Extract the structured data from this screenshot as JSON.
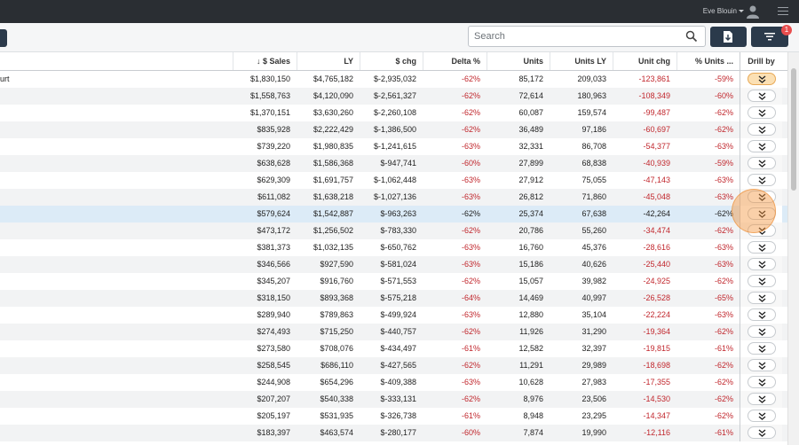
{
  "header": {
    "user_name": "Eve Blouin"
  },
  "toolbar": {
    "search_placeholder": "Search",
    "filter_badge": "1"
  },
  "columns": {
    "sales": "↓ $ Sales",
    "ly": "LY",
    "chg": "$ chg",
    "delta": "Delta %",
    "units": "Units",
    "units_ly": "Units LY",
    "unit_chg": "Unit chg",
    "pct_units": "% Units ...",
    "drill": "Drill by"
  },
  "rows": [
    {
      "name": "urt",
      "sales": "$1,830,150",
      "ly": "$4,765,182",
      "chg": "$-2,935,032",
      "delta": "-62%",
      "units": "85,172",
      "units_ly": "209,033",
      "unit_chg": "-123,861",
      "pct": "-59%"
    },
    {
      "name": "",
      "sales": "$1,558,763",
      "ly": "$4,120,090",
      "chg": "$-2,561,327",
      "delta": "-62%",
      "units": "72,614",
      "units_ly": "180,963",
      "unit_chg": "-108,349",
      "pct": "-60%"
    },
    {
      "name": "",
      "sales": "$1,370,151",
      "ly": "$3,630,260",
      "chg": "$-2,260,108",
      "delta": "-62%",
      "units": "60,087",
      "units_ly": "159,574",
      "unit_chg": "-99,487",
      "pct": "-62%"
    },
    {
      "name": "",
      "sales": "$835,928",
      "ly": "$2,222,429",
      "chg": "$-1,386,500",
      "delta": "-62%",
      "units": "36,489",
      "units_ly": "97,186",
      "unit_chg": "-60,697",
      "pct": "-62%"
    },
    {
      "name": "",
      "sales": "$739,220",
      "ly": "$1,980,835",
      "chg": "$-1,241,615",
      "delta": "-63%",
      "units": "32,331",
      "units_ly": "86,708",
      "unit_chg": "-54,377",
      "pct": "-63%"
    },
    {
      "name": "",
      "sales": "$638,628",
      "ly": "$1,586,368",
      "chg": "$-947,741",
      "delta": "-60%",
      "units": "27,899",
      "units_ly": "68,838",
      "unit_chg": "-40,939",
      "pct": "-59%"
    },
    {
      "name": "",
      "sales": "$629,309",
      "ly": "$1,691,757",
      "chg": "$-1,062,448",
      "delta": "-63%",
      "units": "27,912",
      "units_ly": "75,055",
      "unit_chg": "-47,143",
      "pct": "-63%"
    },
    {
      "name": "",
      "sales": "$611,082",
      "ly": "$1,638,218",
      "chg": "$-1,027,136",
      "delta": "-63%",
      "units": "26,812",
      "units_ly": "71,860",
      "unit_chg": "-45,048",
      "pct": "-63%"
    },
    {
      "name": "",
      "sales": "$579,624",
      "ly": "$1,542,887",
      "chg": "$-963,263",
      "delta": "-62%",
      "units": "25,374",
      "units_ly": "67,638",
      "unit_chg": "-42,264",
      "pct": "-62%"
    },
    {
      "name": "",
      "sales": "$473,172",
      "ly": "$1,256,502",
      "chg": "$-783,330",
      "delta": "-62%",
      "units": "20,786",
      "units_ly": "55,260",
      "unit_chg": "-34,474",
      "pct": "-62%"
    },
    {
      "name": "",
      "sales": "$381,373",
      "ly": "$1,032,135",
      "chg": "$-650,762",
      "delta": "-63%",
      "units": "16,760",
      "units_ly": "45,376",
      "unit_chg": "-28,616",
      "pct": "-63%"
    },
    {
      "name": "",
      "sales": "$346,566",
      "ly": "$927,590",
      "chg": "$-581,024",
      "delta": "-63%",
      "units": "15,186",
      "units_ly": "40,626",
      "unit_chg": "-25,440",
      "pct": "-63%"
    },
    {
      "name": "",
      "sales": "$345,207",
      "ly": "$916,760",
      "chg": "$-571,553",
      "delta": "-62%",
      "units": "15,057",
      "units_ly": "39,982",
      "unit_chg": "-24,925",
      "pct": "-62%"
    },
    {
      "name": "",
      "sales": "$318,150",
      "ly": "$893,368",
      "chg": "$-575,218",
      "delta": "-64%",
      "units": "14,469",
      "units_ly": "40,997",
      "unit_chg": "-26,528",
      "pct": "-65%"
    },
    {
      "name": "",
      "sales": "$289,940",
      "ly": "$789,863",
      "chg": "$-499,924",
      "delta": "-63%",
      "units": "12,880",
      "units_ly": "35,104",
      "unit_chg": "-22,224",
      "pct": "-63%"
    },
    {
      "name": "",
      "sales": "$274,493",
      "ly": "$715,250",
      "chg": "$-440,757",
      "delta": "-62%",
      "units": "11,926",
      "units_ly": "31,290",
      "unit_chg": "-19,364",
      "pct": "-62%"
    },
    {
      "name": "",
      "sales": "$273,580",
      "ly": "$708,076",
      "chg": "$-434,497",
      "delta": "-61%",
      "units": "12,582",
      "units_ly": "32,397",
      "unit_chg": "-19,815",
      "pct": "-61%"
    },
    {
      "name": "",
      "sales": "$258,545",
      "ly": "$686,110",
      "chg": "$-427,565",
      "delta": "-62%",
      "units": "11,291",
      "units_ly": "29,989",
      "unit_chg": "-18,698",
      "pct": "-62%"
    },
    {
      "name": "",
      "sales": "$244,908",
      "ly": "$654,296",
      "chg": "$-409,388",
      "delta": "-63%",
      "units": "10,628",
      "units_ly": "27,983",
      "unit_chg": "-17,355",
      "pct": "-62%"
    },
    {
      "name": "",
      "sales": "$207,207",
      "ly": "$540,338",
      "chg": "$-333,131",
      "delta": "-62%",
      "units": "8,976",
      "units_ly": "23,506",
      "unit_chg": "-14,530",
      "pct": "-62%"
    },
    {
      "name": "",
      "sales": "$205,197",
      "ly": "$531,935",
      "chg": "$-326,738",
      "delta": "-61%",
      "units": "8,948",
      "units_ly": "23,295",
      "unit_chg": "-14,347",
      "pct": "-62%"
    },
    {
      "name": "",
      "sales": "$183,397",
      "ly": "$463,574",
      "chg": "$-280,177",
      "delta": "-60%",
      "units": "7,874",
      "units_ly": "19,990",
      "unit_chg": "-12,116",
      "pct": "-61%"
    }
  ],
  "highlight_row": 8,
  "active_drill_row": 0,
  "colors": {
    "negative": "#c1272d",
    "dark_button": "#2b3a4b",
    "badge": "#e84d4d",
    "highlight_row": "#dcebf7"
  },
  "icons": {
    "search": "search-icon",
    "export": "export-file-icon",
    "filter": "filter-icon",
    "drill": "double-chevron-down-icon",
    "avatar": "user-avatar-icon",
    "menu": "menu-icon"
  }
}
